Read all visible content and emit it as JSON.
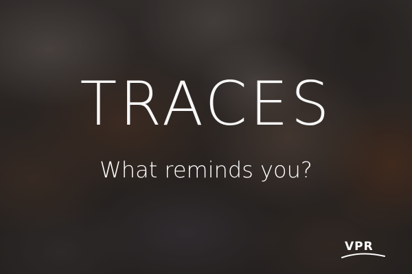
{
  "headline": "TRACES",
  "tagline": "What reminds you?",
  "brand": {
    "logo_text": "VPR"
  },
  "colors": {
    "text": "#ffffff",
    "background": "#2f2a27"
  }
}
